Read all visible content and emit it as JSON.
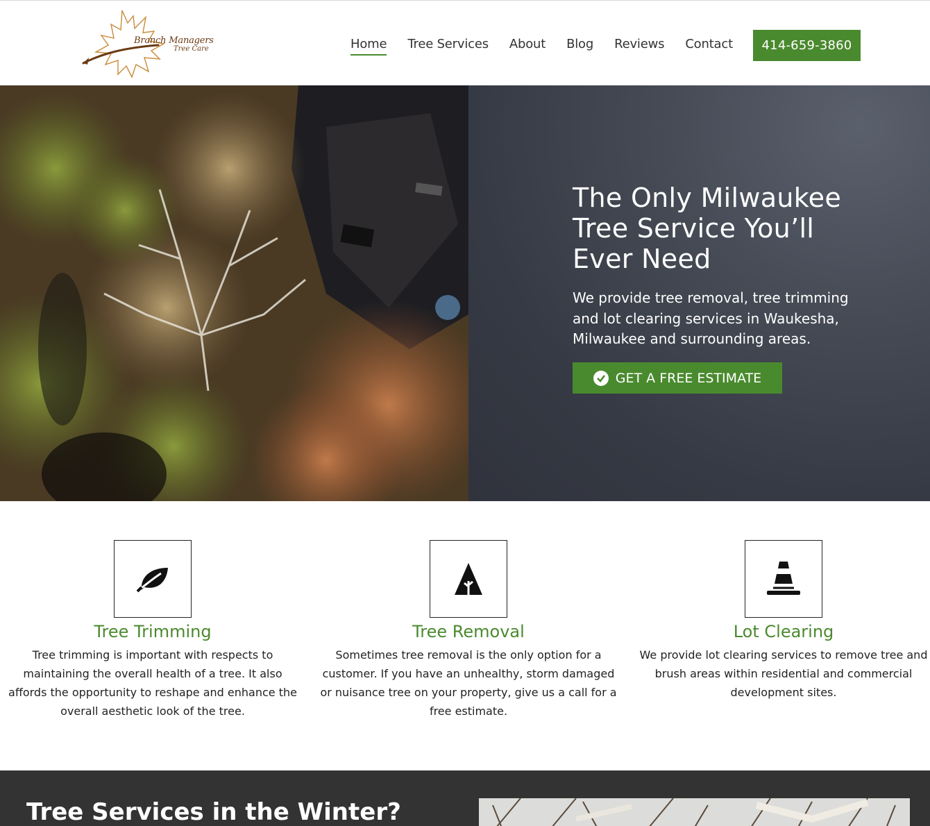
{
  "header": {
    "logo": {
      "line1": "Branch Managers",
      "line2": "Tree Care"
    },
    "nav": [
      {
        "label": "Home",
        "active": true
      },
      {
        "label": "Tree Services",
        "active": false
      },
      {
        "label": "About",
        "active": false
      },
      {
        "label": "Blog",
        "active": false
      },
      {
        "label": "Reviews",
        "active": false
      },
      {
        "label": "Contact",
        "active": false
      }
    ],
    "phone": "414-659-3860"
  },
  "hero": {
    "title": "The Only Milwaukee Tree Service You’ll Ever Need",
    "subtitle": "We provide tree removal, tree trimming and lot clearing services in Waukesha, Milwaukee and surrounding areas.",
    "cta_label": "GET A FREE ESTIMATE",
    "cta_icon": "check-circle-icon"
  },
  "services": [
    {
      "icon": "leaf-icon",
      "title": "Tree Trimming",
      "description": "Tree trimming is important with respects to maintaining the overall health of a tree. It also affords the opportunity to reshape and enhance the overall aesthetic look of the tree."
    },
    {
      "icon": "tree-icon",
      "title": "Tree Removal",
      "description": "Sometimes tree removal is the only option for a customer. If you have an unhealthy, storm damaged or nuisance tree on your property, give us a call for a free estimate."
    },
    {
      "icon": "cone-icon",
      "title": "Lot Clearing",
      "description": "We provide lot clearing services to remove tree and brush areas within residential and commercial development sites."
    }
  ],
  "winter": {
    "title": "Tree Services in the Winter?"
  },
  "colors": {
    "brand_green": "#4a8a2e",
    "hero_panel": "#3e424c",
    "dark_section": "#333333"
  }
}
